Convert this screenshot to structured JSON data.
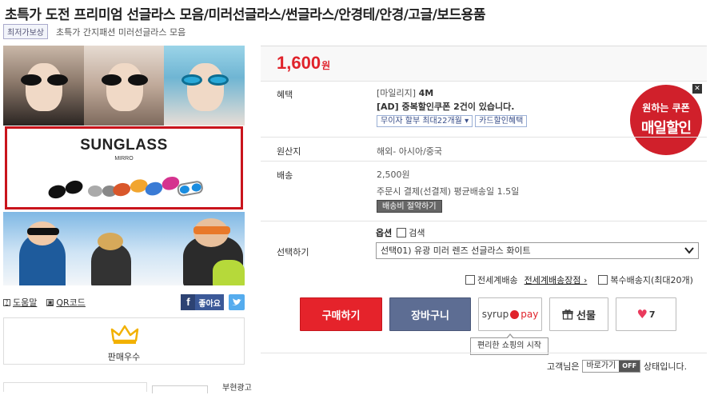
{
  "product": {
    "title": "초특가 도전 프리미엄 선글라스 모음/미러선글라스/썬글라스/안경테/안경/고글/보드용품",
    "badge": "최저가보상",
    "subtitle": "초특가 간지패션 미러선글라스 모음"
  },
  "hero": {
    "banner_title": "SUNGLASS",
    "banner_sub": "MIRRO"
  },
  "utils": {
    "help": "도움말",
    "qr": "QR코드",
    "like": "좋아요"
  },
  "seller": {
    "label": "판매우수"
  },
  "bottom": {
    "partial_text": "부현광고"
  },
  "price": {
    "amount": "1,600",
    "unit": "원"
  },
  "benefit": {
    "label": "혜택",
    "line1_prefix": "[마일리지]",
    "line1_value": "4M",
    "line2": "[AD] 중복할인쿠폰 2건이 있습니다.",
    "btn_installment": "무이자 할부 최대22개월",
    "btn_card": "카드할인혜택"
  },
  "coupon": {
    "line1": "원하는 쿠폰",
    "line2": "매일할인",
    "close": "✕"
  },
  "origin": {
    "label": "원산지",
    "value": "해외- 아시아/중국"
  },
  "shipping": {
    "label": "배송",
    "fee": "2,500원",
    "info": "주문시 결제(선결제) 평균배송일 1.5일",
    "save_button": "배송비 절약하기"
  },
  "select": {
    "label": "선택하기",
    "option_title": "옵션",
    "search_label": "검색",
    "selected": "선택01) 유광 미러 렌즈 선글라스 화이트"
  },
  "ship_options": {
    "global": "전세계배송",
    "global_shop": "전세계배송장점",
    "multi": "복수배송지(최대20개)"
  },
  "actions": {
    "buy": "구매하기",
    "cart": "장바구니",
    "syrup": "syrup",
    "pay": "pay",
    "gift": "선물",
    "like_count": "7"
  },
  "tooltip": {
    "text": "편리한 쇼핑의 시작"
  },
  "shortcut": {
    "prefix": "고객님은",
    "button": "바로가기",
    "state": "OFF",
    "suffix": "상태입니다."
  },
  "colors": {
    "price_red": "#e0232b",
    "buy_red": "#e5232b",
    "cart_blue": "#5d6d93",
    "banner_border": "#c9141c"
  }
}
